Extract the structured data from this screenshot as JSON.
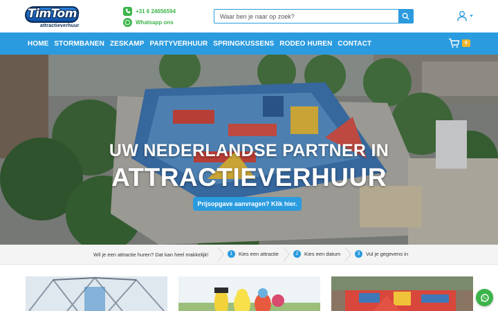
{
  "header": {
    "logo_text": "TimTom",
    "logo_sub": "attractieverhuur",
    "phone": "+31 6 24656594",
    "whatsapp": "Whatsapp ons",
    "search_placeholder": "Waar ben je naar op zoek?"
  },
  "nav": {
    "items": [
      "HOME",
      "STORMBANEN",
      "ZESKAMP",
      "PARTYVERHUUR",
      "SPRINGKUSSENS",
      "RODEO HUREN",
      "CONTACT"
    ],
    "cart_count": "0"
  },
  "hero": {
    "title_line1": "UW NEDERLANDSE PARTNER IN",
    "title_line2": "ATTRACTIEVERHUUR",
    "cta": "Prijsopgave aanvragen? Klik hier."
  },
  "steps": {
    "intro": "Wil je een attractie huren? Dat kan heel makkelijk!",
    "items": [
      {
        "num": "1",
        "label": "Kies een attractie"
      },
      {
        "num": "2",
        "label": "Kies een datum"
      },
      {
        "num": "3",
        "label": "Vul je gegevens in"
      }
    ]
  },
  "colors": {
    "primary": "#2b9bdf",
    "green": "#3bb54a",
    "badge": "#f0b42c"
  },
  "icons": [
    "phone-icon",
    "whatsapp-icon",
    "search-icon",
    "user-icon",
    "cart-icon",
    "whatsapp-float-icon"
  ]
}
